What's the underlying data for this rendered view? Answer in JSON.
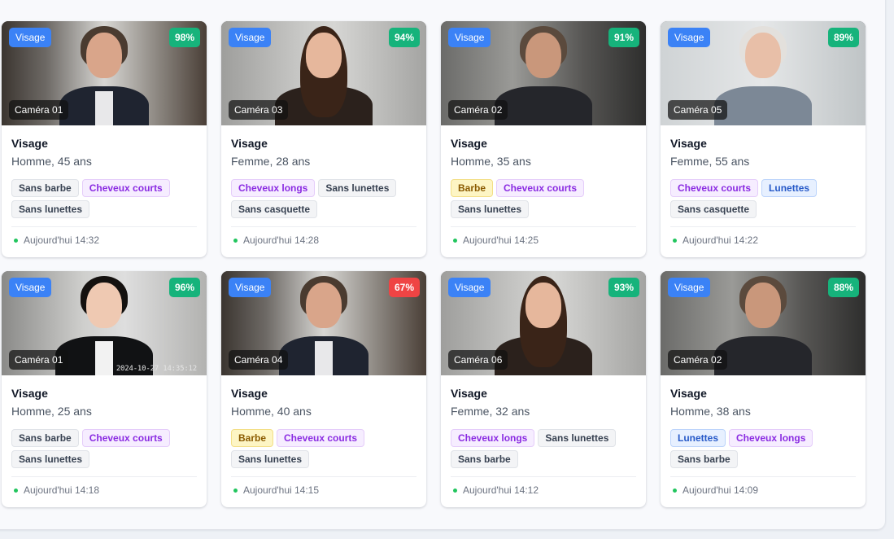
{
  "colors": {
    "type_badge": "#3b82f6",
    "score_high": "#16b37b",
    "score_low": "#ef4444",
    "live_dot": "#22c55e"
  },
  "cards": [
    {
      "type": "Visage",
      "score": "98%",
      "score_level": "high",
      "camera": "Caméra 01",
      "stamp": "",
      "scene": "office",
      "person": "man-suit",
      "title": "Visage",
      "subtitle": "Homme, 45 ans",
      "tags": [
        {
          "label": "Sans barbe",
          "style": "neutral"
        },
        {
          "label": "Cheveux courts",
          "style": "purple"
        },
        {
          "label": "Sans lunettes",
          "style": "neutral"
        }
      ],
      "time": "Aujourd'hui 14:32"
    },
    {
      "type": "Visage",
      "score": "94%",
      "score_level": "high",
      "camera": "Caméra 03",
      "stamp": "",
      "scene": "studio",
      "person": "woman-dark",
      "title": "Visage",
      "subtitle": "Femme, 28 ans",
      "tags": [
        {
          "label": "Cheveux longs",
          "style": "purple"
        },
        {
          "label": "Sans lunettes",
          "style": "neutral"
        },
        {
          "label": "Sans casquette",
          "style": "neutral"
        }
      ],
      "time": "Aujourd'hui 14:28"
    },
    {
      "type": "Visage",
      "score": "91%",
      "score_level": "high",
      "camera": "Caméra 02",
      "stamp": "",
      "scene": "dark",
      "person": "man-beard",
      "title": "Visage",
      "subtitle": "Homme, 35 ans",
      "tags": [
        {
          "label": "Barbe",
          "style": "yellow"
        },
        {
          "label": "Cheveux courts",
          "style": "purple"
        },
        {
          "label": "Sans lunettes",
          "style": "neutral"
        }
      ],
      "time": "Aujourd'hui 14:25"
    },
    {
      "type": "Visage",
      "score": "89%",
      "score_level": "high",
      "camera": "Caméra 05",
      "stamp": "",
      "scene": "bright",
      "person": "elder-woman",
      "title": "Visage",
      "subtitle": "Femme, 55 ans",
      "tags": [
        {
          "label": "Cheveux courts",
          "style": "purple"
        },
        {
          "label": "Lunettes",
          "style": "blue"
        },
        {
          "label": "Sans casquette",
          "style": "neutral"
        }
      ],
      "time": "Aujourd'hui 14:22"
    },
    {
      "type": "Visage",
      "score": "96%",
      "score_level": "high",
      "camera": "Caméra 01",
      "stamp": "2024-10-27 14:35:12",
      "scene": "soft",
      "person": "young-man",
      "title": "Visage",
      "subtitle": "Homme, 25 ans",
      "tags": [
        {
          "label": "Sans barbe",
          "style": "neutral"
        },
        {
          "label": "Cheveux courts",
          "style": "purple"
        },
        {
          "label": "Sans lunettes",
          "style": "neutral"
        }
      ],
      "time": "Aujourd'hui 14:18"
    },
    {
      "type": "Visage",
      "score": "67%",
      "score_level": "low",
      "camera": "Caméra 04",
      "stamp": "",
      "scene": "office",
      "person": "man-suit",
      "title": "Visage",
      "subtitle": "Homme, 40 ans",
      "tags": [
        {
          "label": "Barbe",
          "style": "yellow"
        },
        {
          "label": "Cheveux courts",
          "style": "purple"
        },
        {
          "label": "Sans lunettes",
          "style": "neutral"
        }
      ],
      "time": "Aujourd'hui 14:15"
    },
    {
      "type": "Visage",
      "score": "93%",
      "score_level": "high",
      "camera": "Caméra 06",
      "stamp": "",
      "scene": "studio",
      "person": "woman-dark",
      "title": "Visage",
      "subtitle": "Femme, 32 ans",
      "tags": [
        {
          "label": "Cheveux longs",
          "style": "purple"
        },
        {
          "label": "Sans lunettes",
          "style": "neutral"
        },
        {
          "label": "Sans barbe",
          "style": "neutral"
        }
      ],
      "time": "Aujourd'hui 14:12"
    },
    {
      "type": "Visage",
      "score": "88%",
      "score_level": "high",
      "camera": "Caméra 02",
      "stamp": "",
      "scene": "dark",
      "person": "man-beard",
      "title": "Visage",
      "subtitle": "Homme, 38 ans",
      "tags": [
        {
          "label": "Lunettes",
          "style": "blue"
        },
        {
          "label": "Cheveux longs",
          "style": "purple"
        },
        {
          "label": "Sans barbe",
          "style": "neutral"
        }
      ],
      "time": "Aujourd'hui 14:09"
    }
  ]
}
